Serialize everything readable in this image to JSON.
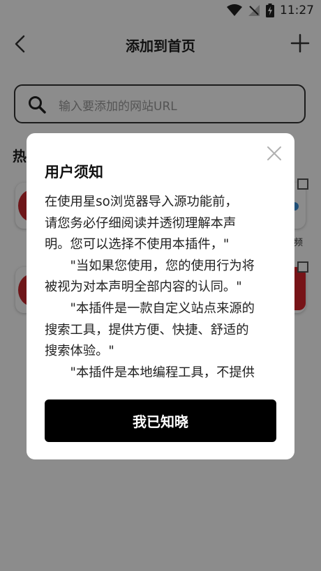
{
  "status_bar": {
    "time": "11:27",
    "icons": [
      "wifi-icon",
      "no-signal-icon",
      "battery-charging-icon"
    ]
  },
  "nav": {
    "title": "添加到首页",
    "back_icon": "chevron-left-icon",
    "add_icon": "plus-icon"
  },
  "search": {
    "placeholder": "输入要添加的网站URL",
    "icon": "search-icon"
  },
  "background": {
    "section_title_visible": "热",
    "partial_label": "频"
  },
  "dialog": {
    "title": "用户须知",
    "paragraphs": [
      "在使用星so浏览器导入源功能前，",
      "请您务必仔细阅读并透彻理解本声",
      "明。您可以选择不使用本插件，\"",
      "　　\"当如果您使用，您的使用行为将",
      "被视为对本声明全部内容的认同。\"",
      "　　\"本插件是一款自定义站点来源的",
      "搜索工具，提供方便、快捷、舒适的",
      "搜索体验。\"",
      "　　\"本插件是本地编程工具，不提供"
    ],
    "confirm_label": "我已知晓",
    "close_icon": "close-icon"
  },
  "colors": {
    "overlay": "#000000",
    "primary_button": "#000000",
    "accent_red": "#d9262c"
  }
}
